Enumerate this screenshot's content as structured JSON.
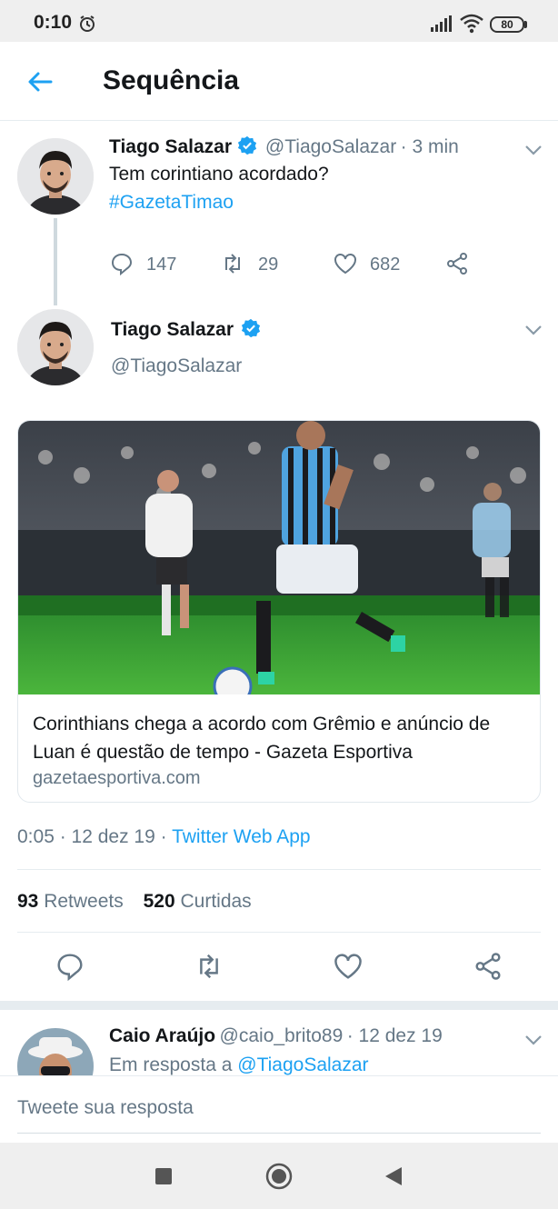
{
  "status_bar": {
    "time": "0:10",
    "battery": "80"
  },
  "header": {
    "title": "Sequência"
  },
  "tweet1": {
    "name": "Tiago Salazar",
    "handle": "@TiagoSalazar",
    "time": "· 3 min",
    "text": "Tem corintiano acordado?",
    "hashtag": "#GazetaTimao",
    "replies": "147",
    "retweets": "29",
    "likes": "682"
  },
  "tweet2": {
    "name": "Tiago Salazar",
    "handle": "@TiagoSalazar",
    "card": {
      "title": "Corinthians chega a acordo com Grêmio e anúncio de Luan é questão de tempo - Gazeta Esportiva",
      "domain": "gazetaesportiva.com"
    },
    "meta": "0:05 · 12 dez 19 ·",
    "source": "Twitter Web App",
    "retweet_count": "93",
    "retweet_label": "Retweets",
    "like_count": "520",
    "like_label": "Curtidas"
  },
  "reply": {
    "name": "Caio Araújo",
    "handle": "@caio_brito89",
    "time": "· 12 dez 19",
    "in_reply_prefix": "Em resposta a",
    "in_reply_handle": "@TiagoSalazar"
  },
  "composer": {
    "placeholder": "Tweete sua resposta"
  },
  "colors": {
    "accent": "#1da1f2",
    "text": "#14171a",
    "secondary": "#657786",
    "divider": "#e6ecf0"
  }
}
